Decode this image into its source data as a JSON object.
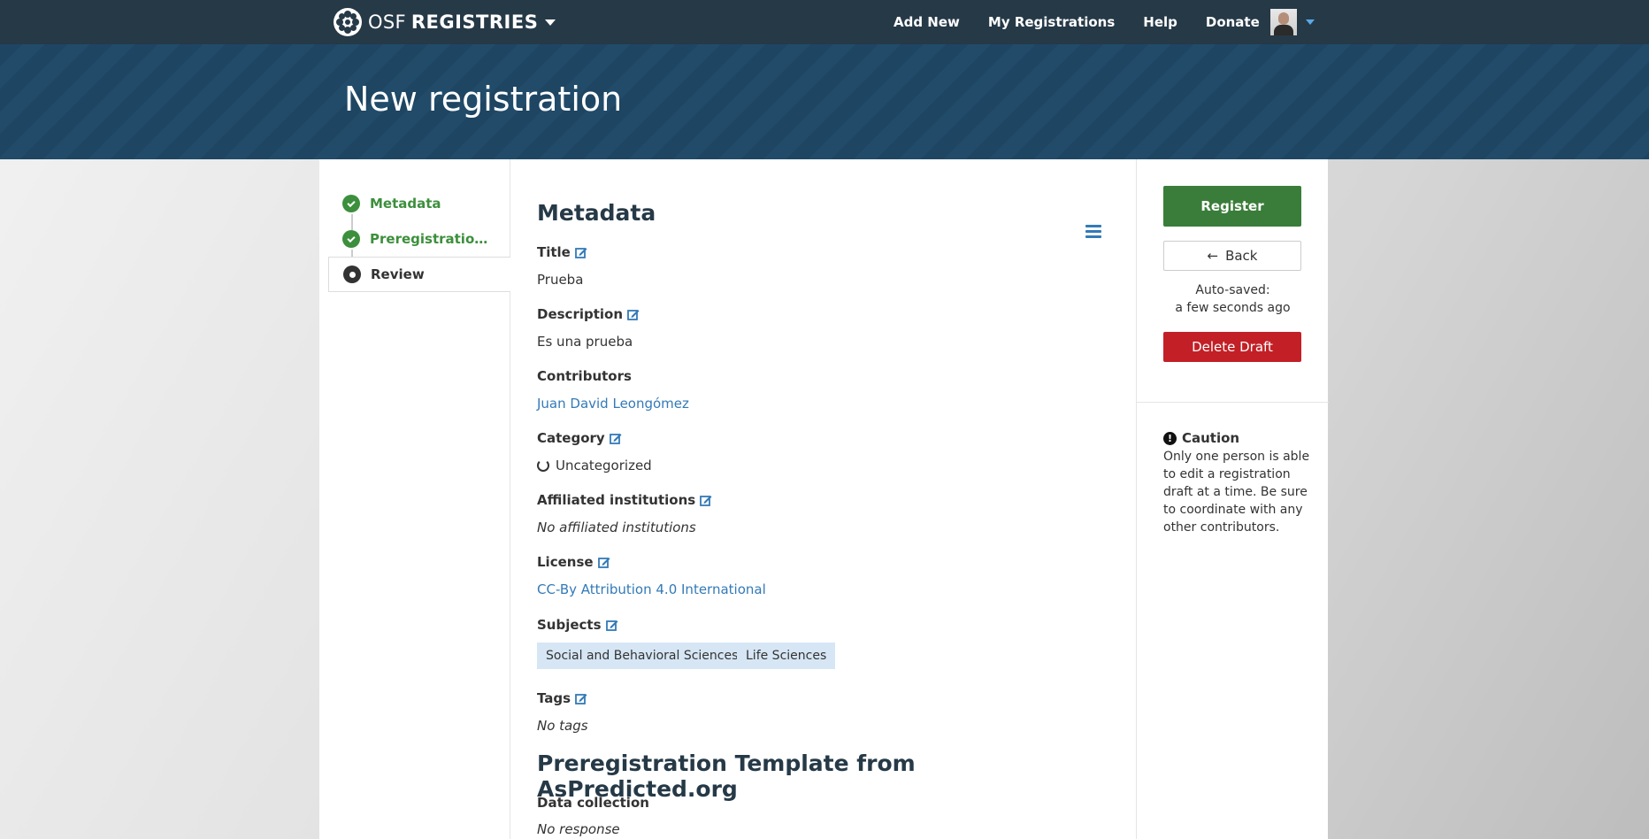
{
  "nav": {
    "brand_osf": "OSF",
    "brand_registries": "REGISTRIES",
    "links": [
      "Add New",
      "My Registrations",
      "Help",
      "Donate"
    ]
  },
  "banner": {
    "title": "New registration"
  },
  "steps": [
    {
      "label": "Metadata",
      "state": "done"
    },
    {
      "label": "Preregistration Te...",
      "state": "done"
    },
    {
      "label": "Review",
      "state": "current"
    }
  ],
  "metadata": {
    "heading": "Metadata",
    "title_label": "Title",
    "title_value": "Prueba",
    "description_label": "Description",
    "description_value": "Es una prueba",
    "contributors_label": "Contributors",
    "contributors_value": "Juan David Leongómez",
    "category_label": "Category",
    "category_value": "Uncategorized",
    "affiliated_label": "Affiliated institutions",
    "affiliated_value": "No affiliated institutions",
    "license_label": "License",
    "license_value": "CC-By Attribution 4.0 International",
    "subjects_label": "Subjects",
    "subjects": [
      "Social and Behavioral Sciences",
      "Life Sciences"
    ],
    "tags_label": "Tags",
    "tags_value": "No tags"
  },
  "prereg": {
    "heading": "Preregistration Template from AsPredicted.org",
    "data_collection_label": "Data collection",
    "data_collection_value": "No response"
  },
  "sidebar": {
    "register_label": "Register",
    "back_label": "Back",
    "autosave_line1": "Auto-saved:",
    "autosave_line2": "a few seconds ago",
    "delete_label": "Delete Draft",
    "caution_title": "Caution",
    "caution_text": "Only one person is able to edit a registration draft at a time. Be sure to coordinate with any other contributors."
  },
  "colors": {
    "nav_bg": "#263947",
    "success": "#3a7d3a",
    "danger": "#c22026",
    "link": "#337ab7"
  }
}
